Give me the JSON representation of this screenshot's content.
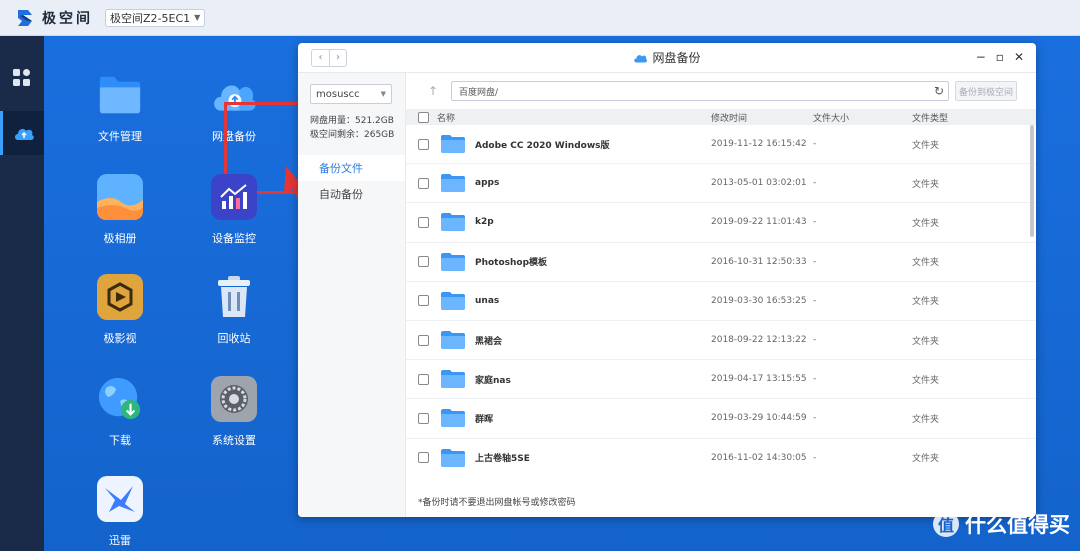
{
  "topbar": {
    "brand": "极空间",
    "device": "极空间Z2-5EC1"
  },
  "apps": [
    {
      "label": "文件管理"
    },
    {
      "label": "网盘备份"
    },
    {
      "label": "极相册"
    },
    {
      "label": "设备监控"
    },
    {
      "label": "极影视"
    },
    {
      "label": "回收站"
    },
    {
      "label": "下载"
    },
    {
      "label": "系统设置"
    },
    {
      "label": "迅雷"
    }
  ],
  "window": {
    "title": "网盘备份",
    "account": "mosuscc",
    "usage": "网盘用量：521.2GB",
    "remaining": "极空间剩余：265GB",
    "nav": [
      "备份文件",
      "自动备份"
    ],
    "path": "百度网盘/",
    "backup_btn": "备份到极空间",
    "columns": {
      "name": "名称",
      "time": "修改时间",
      "size": "文件大小",
      "type": "文件类型"
    },
    "files": [
      {
        "name": "Adobe CC 2020 Windows版",
        "time": "2019-11-12 16:15:42",
        "size": "-",
        "type": "文件夹"
      },
      {
        "name": "apps",
        "time": "2013-05-01 03:02:01",
        "size": "-",
        "type": "文件夹"
      },
      {
        "name": "k2p",
        "time": "2019-09-22 11:01:43",
        "size": "-",
        "type": "文件夹"
      },
      {
        "name": "Photoshop模板",
        "time": "2016-10-31 12:50:33",
        "size": "-",
        "type": "文件夹"
      },
      {
        "name": "unas",
        "time": "2019-03-30 16:53:25",
        "size": "-",
        "type": "文件夹"
      },
      {
        "name": "黑裙会",
        "time": "2018-09-22 12:13:22",
        "size": "-",
        "type": "文件夹"
      },
      {
        "name": "家庭nas",
        "time": "2019-04-17 13:15:55",
        "size": "-",
        "type": "文件夹"
      },
      {
        "name": "群晖",
        "time": "2019-03-29 10:44:59",
        "size": "-",
        "type": "文件夹"
      },
      {
        "name": "上古卷轴5SE",
        "time": "2016-11-02 14:30:05",
        "size": "-",
        "type": "文件夹"
      }
    ],
    "footnote": "*备份时请不要退出网盘帐号或修改密码"
  },
  "watermark": "什么值得买",
  "colors": {
    "accent": "#2b7de0",
    "desktop": "#1667d6",
    "rail": "#1a2b4a",
    "highlight": "#e53535"
  }
}
